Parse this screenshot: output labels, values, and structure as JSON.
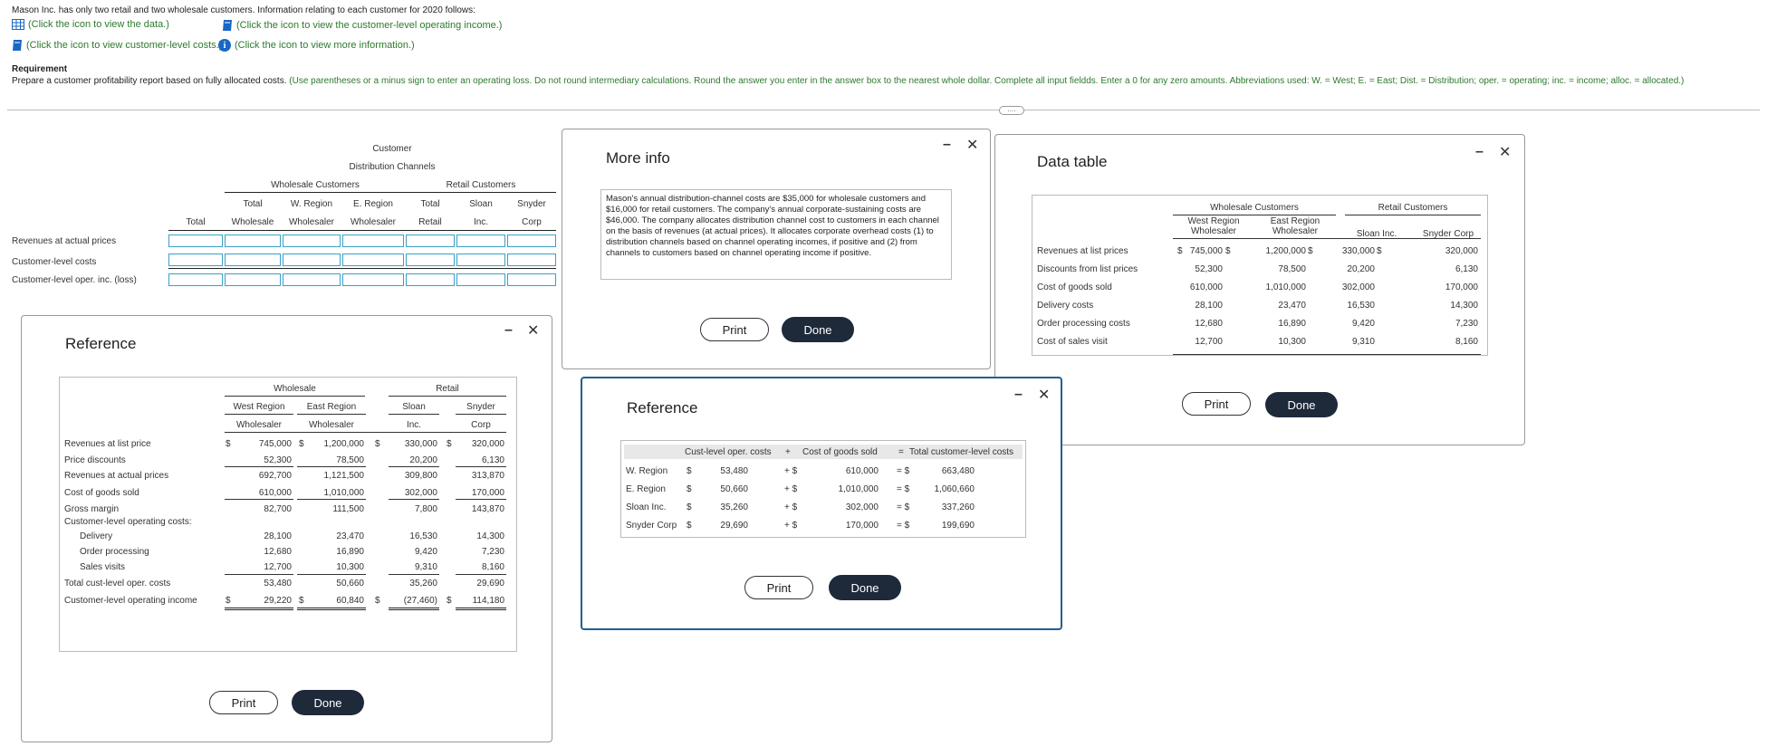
{
  "intro": {
    "text": "Mason Inc. has only two retail and two wholesale customers. Information relating to each customer for 2020 follows:",
    "link_data": "(Click the icon to view the data.)",
    "link_income": "(Click the icon to view the customer-level operating income.)",
    "link_costs": "(Click the icon to view customer-level costs.)",
    "link_info": "(Click the icon to view more information.)"
  },
  "requirement": {
    "heading": "Requirement",
    "text_black": "Prepare a customer profitability report based on fully allocated costs.",
    "text_green": "(Use parentheses or a minus sign to enter an operating loss. Do not round intermediary calculations. Round the answer you enter in the answer box to the nearest whole dollar. Complete all input fieldds. Enter a 0 for any zero amounts. Abbreviations used: W. = West; E. = East; Dist. = Distribution; oper. = operating; inc. = income; alloc. = allocated.)"
  },
  "divider_handle": "....",
  "answer_table": {
    "h_customer": "Customer",
    "h_channels": "Distribution Channels",
    "h_wholesale": "Wholesale Customers",
    "h_retail": "Retail Customers",
    "cols": [
      {
        "l1": "",
        "l2": "Total"
      },
      {
        "l1": "Total",
        "l2": "Wholesale"
      },
      {
        "l1": "W. Region",
        "l2": "Wholesaler"
      },
      {
        "l1": "E. Region",
        "l2": "Wholesaler"
      },
      {
        "l1": "Total",
        "l2": "Retail"
      },
      {
        "l1": "Sloan",
        "l2": "Inc."
      },
      {
        "l1": "Snyder",
        "l2": "Corp"
      }
    ],
    "rows": [
      "Revenues at actual prices",
      "Customer-level costs",
      "Customer-level oper. inc. (loss)"
    ]
  },
  "ref_left": {
    "title": "Reference",
    "h_wholesale": "Wholesale",
    "h_retail": "Retail",
    "cols": [
      {
        "l1": "West Region",
        "l2": "Wholesaler"
      },
      {
        "l1": "East Region",
        "l2": "Wholesaler"
      },
      {
        "l1": "Sloan",
        "l2": "Inc."
      },
      {
        "l1": "Snyder",
        "l2": "Corp"
      }
    ],
    "rows": [
      {
        "label": "Revenues at list price",
        "dollar": true,
        "values": [
          "745,000",
          "1,200,000",
          "330,000",
          "320,000"
        ]
      },
      {
        "label": "Price discounts",
        "values": [
          "52,300",
          "78,500",
          "20,200",
          "6,130"
        ]
      },
      {
        "label": "Revenues at actual prices",
        "values": [
          "692,700",
          "1,121,500",
          "309,800",
          "313,870"
        ]
      },
      {
        "label": "Cost of goods sold",
        "values": [
          "610,000",
          "1,010,000",
          "302,000",
          "170,000"
        ]
      },
      {
        "label": "Gross margin",
        "values": [
          "82,700",
          "111,500",
          "7,800",
          "143,870"
        ]
      },
      {
        "label": "Customer-level operating costs:",
        "values": [
          "",
          "",
          "",
          ""
        ]
      },
      {
        "label": "Delivery",
        "indent": true,
        "values": [
          "28,100",
          "23,470",
          "16,530",
          "14,300"
        ]
      },
      {
        "label": "Order processing",
        "indent": true,
        "values": [
          "12,680",
          "16,890",
          "9,420",
          "7,230"
        ]
      },
      {
        "label": "Sales visits",
        "indent": true,
        "values": [
          "12,700",
          "10,300",
          "9,310",
          "8,160"
        ]
      },
      {
        "label": "Total cust-level oper. costs",
        "values": [
          "53,480",
          "50,660",
          "35,260",
          "29,690"
        ]
      },
      {
        "label": "Customer-level operating income",
        "dollar": true,
        "values": [
          "29,220",
          "60,840",
          "(27,460)",
          "114,180"
        ]
      }
    ],
    "print": "Print",
    "done": "Done"
  },
  "more_info": {
    "title": "More info",
    "text": "Mason's annual distribution-channel costs are $35,000 for wholesale customers and $16,000 for retail customers. The company's annual corporate-sustaining costs are $46,000. The company allocates distribution channel cost to customers in each channel on the basis of revenues (at actual prices). It allocates corporate overhead costs (1) to distribution channels based on channel operating incomes, if positive and (2) from channels to customers based on channel operating income if positive.",
    "print": "Print",
    "done": "Done"
  },
  "ref_mid": {
    "title": "Reference",
    "headers": [
      "Cust-level oper. costs",
      "+",
      "Cost of goods sold",
      "=",
      "Total customer-level costs"
    ],
    "rows": [
      {
        "label": "W. Region",
        "a": "53,480",
        "b": "610,000",
        "c": "663,480"
      },
      {
        "label": "E. Region",
        "a": "50,660",
        "b": "1,010,000",
        "c": "1,060,660"
      },
      {
        "label": "Sloan Inc.",
        "a": "35,260",
        "b": "302,000",
        "c": "337,260"
      },
      {
        "label": "Snyder Corp",
        "a": "29,690",
        "b": "170,000",
        "c": "199,690"
      }
    ],
    "print": "Print",
    "done": "Done"
  },
  "data_table": {
    "title": "Data table",
    "h_wholesale": "Wholesale Customers",
    "h_retail": "Retail Customers",
    "cols": [
      {
        "l1": "West Region",
        "l2": "Wholesaler"
      },
      {
        "l1": "East Region",
        "l2": "Wholesaler"
      },
      {
        "l1": "",
        "l2": "Sloan Inc."
      },
      {
        "l1": "",
        "l2": "Snyder Corp"
      }
    ],
    "rows": [
      {
        "label": "Revenues at list prices",
        "dollar": true,
        "values": [
          "745,000",
          "1,200,000",
          "330,000",
          "320,000"
        ]
      },
      {
        "label": "Discounts from list prices",
        "values": [
          "52,300",
          "78,500",
          "20,200",
          "6,130"
        ]
      },
      {
        "label": "Cost of goods sold",
        "values": [
          "610,000",
          "1,010,000",
          "302,000",
          "170,000"
        ]
      },
      {
        "label": "Delivery costs",
        "values": [
          "28,100",
          "23,470",
          "16,530",
          "14,300"
        ]
      },
      {
        "label": "Order processing costs",
        "values": [
          "12,680",
          "16,890",
          "9,420",
          "7,230"
        ]
      },
      {
        "label": "Cost of sales visit",
        "values": [
          "12,700",
          "10,300",
          "9,310",
          "8,160"
        ]
      }
    ],
    "print": "Print",
    "done": "Done"
  },
  "symbols": {
    "dollar": "$",
    "plus_dollar": "+ $",
    "eq_dollar": "= $",
    "minimize": "–",
    "close": "✕"
  }
}
